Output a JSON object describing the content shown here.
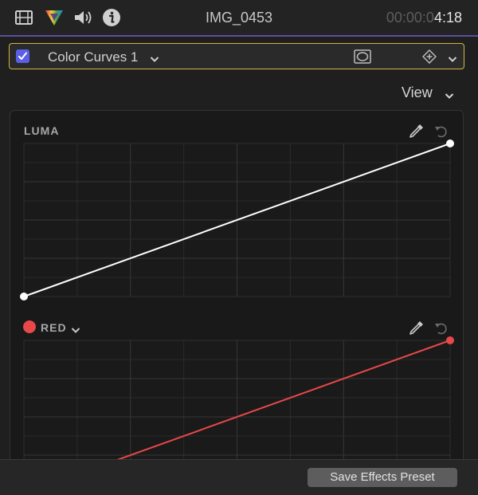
{
  "header": {
    "title": "IMG_0453",
    "timecode_dim": "00:00:0",
    "timecode_bright": "4:18"
  },
  "effect": {
    "enabled": true,
    "name": "Color Curves 1"
  },
  "view_menu": {
    "label": "View"
  },
  "luma": {
    "label": "LUMA",
    "curve_color": "#ffffff",
    "points": [
      {
        "in": 0,
        "out": 0
      },
      {
        "in": 1,
        "out": 1
      }
    ]
  },
  "red": {
    "label": "RED",
    "curve_color": "#e8484a",
    "points": [
      {
        "in": 0,
        "out": 0
      },
      {
        "in": 1,
        "out": 1
      }
    ]
  },
  "footer": {
    "save_preset_label": "Save Effects Preset"
  },
  "colors": {
    "accent_border": "#d7b441",
    "checkbox": "#5b5ee6",
    "top_line": "#5a4f9c",
    "red_channel": "#e8484a"
  }
}
